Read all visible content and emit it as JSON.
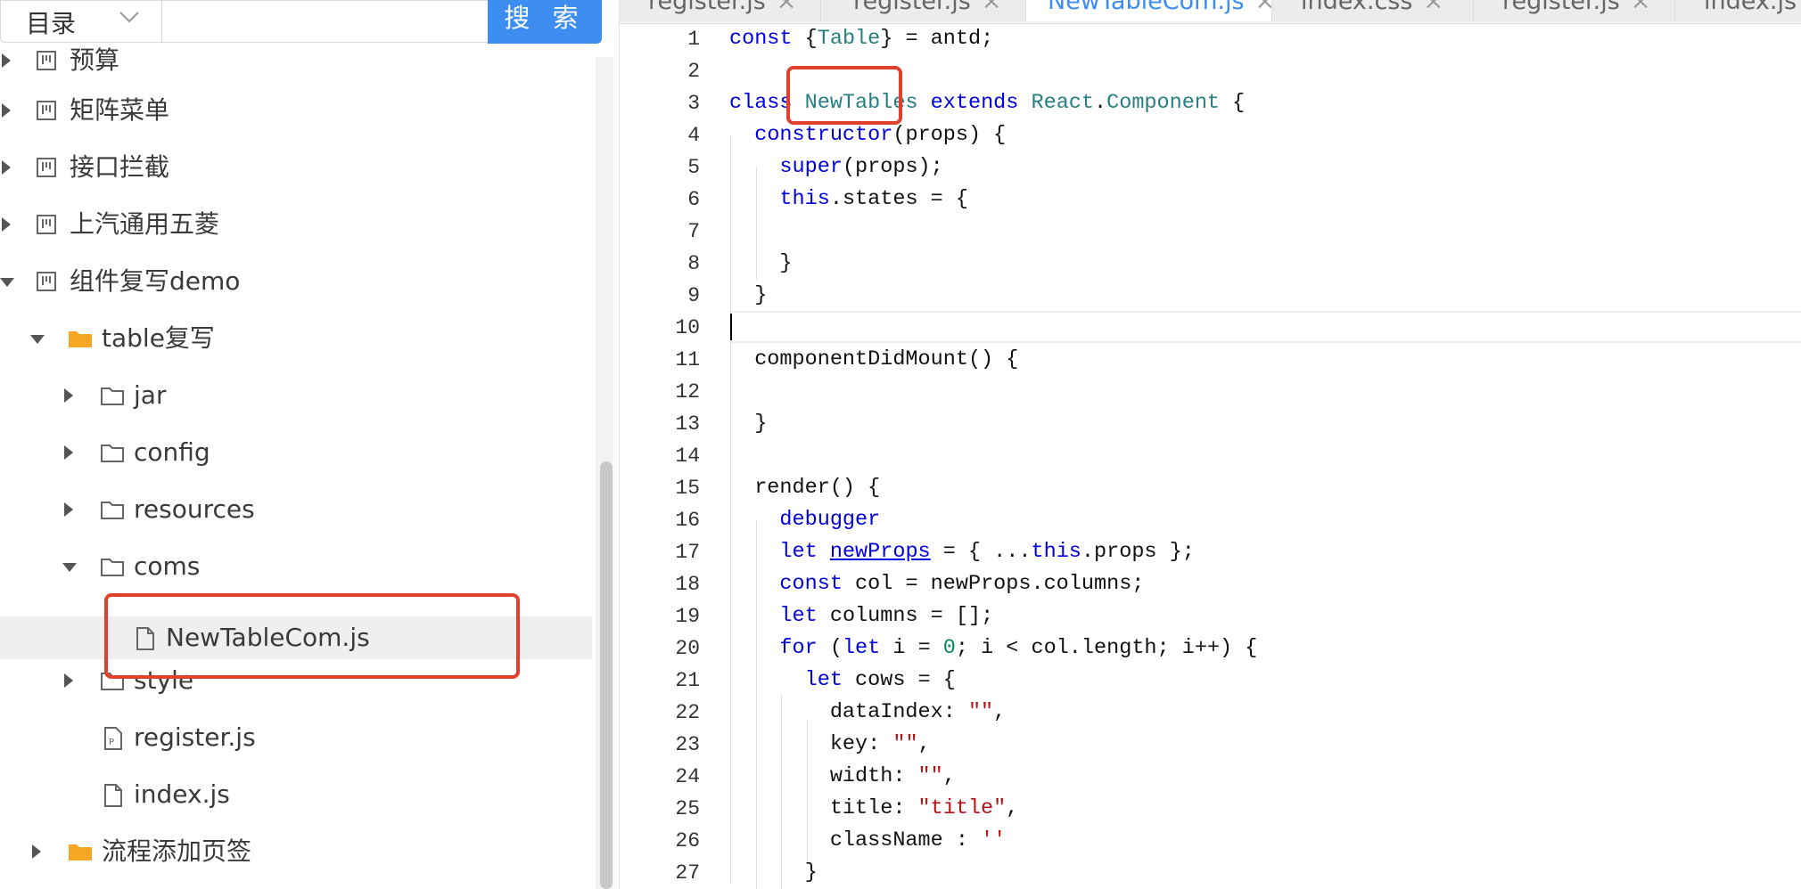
{
  "search": {
    "scope_label": "目录",
    "button_label": "搜 索"
  },
  "tree": {
    "nodes": [
      {
        "label": "预算"
      },
      {
        "label": "矩阵菜单"
      },
      {
        "label": "接口拦截"
      },
      {
        "label": "上汽通用五菱"
      },
      {
        "label": "组件复写demo"
      },
      {
        "label": "table复写"
      },
      {
        "label": "jar"
      },
      {
        "label": "config"
      },
      {
        "label": "resources"
      },
      {
        "label": "coms"
      },
      {
        "label": "NewTableCom.js"
      },
      {
        "label": "style"
      },
      {
        "label": "register.js"
      },
      {
        "label": "index.js"
      },
      {
        "label": "流程添加页签"
      }
    ]
  },
  "tabs": [
    {
      "label": "register.js"
    },
    {
      "label": "register.js"
    },
    {
      "label": "NewTableCom.js"
    },
    {
      "label": "index.css"
    },
    {
      "label": "register.js"
    },
    {
      "label": "index.js"
    }
  ],
  "editor": {
    "line_numbers": [
      "1",
      "2",
      "3",
      "4",
      "5",
      "6",
      "7",
      "8",
      "9",
      "10",
      "11",
      "12",
      "13",
      "14",
      "15",
      "16",
      "17",
      "18",
      "19",
      "20",
      "21",
      "22",
      "23",
      "24",
      "25",
      "26",
      "27"
    ],
    "code": {
      "l1_a": "const",
      "l1_b": " {",
      "l1_c": "Table",
      "l1_d": "} = antd;",
      "l3_a": "class",
      "l3_b": " ",
      "l3_c": "NewTables",
      "l3_d": " ",
      "l3_e": "extends",
      "l3_f": " ",
      "l3_g": "React",
      "l3_h": ".",
      "l3_i": "Component",
      "l3_j": " {",
      "l4_a": "  ",
      "l4_b": "constructor",
      "l4_c": "(props) {",
      "l5_a": "    ",
      "l5_b": "super",
      "l5_c": "(props);",
      "l6_a": "    ",
      "l6_b": "this",
      "l6_c": ".states = {",
      "l8": "    }",
      "l9": "  }",
      "l11": "  componentDidMount() {",
      "l13": "  }",
      "l15": "  render() {",
      "l16_a": "    ",
      "l16_b": "debugger",
      "l17_a": "    ",
      "l17_b": "let",
      "l17_c": " ",
      "l17_d": "newProps",
      "l17_e": " = { ...",
      "l17_f": "this",
      "l17_g": ".props };",
      "l18_a": "    ",
      "l18_b": "const",
      "l18_c": " col = newProps.columns;",
      "l19_a": "    ",
      "l19_b": "let",
      "l19_c": " columns = [];",
      "l20_a": "    ",
      "l20_b": "for",
      "l20_c": " (",
      "l20_d": "let",
      "l20_e": " i = ",
      "l20_f": "0",
      "l20_g": "; i < col.length; i++) {",
      "l21_a": "      ",
      "l21_b": "let",
      "l21_c": " cows = {",
      "l22_a": "        dataIndex: ",
      "l22_b": "\"\"",
      "l22_c": ",",
      "l23_a": "        key: ",
      "l23_b": "\"\"",
      "l23_c": ",",
      "l24_a": "        width: ",
      "l24_b": "\"\"",
      "l24_c": ",",
      "l25_a": "        title: ",
      "l25_b": "\"title\"",
      "l25_c": ",",
      "l26_a": "        className : ",
      "l26_b": "''",
      "l27": "      }"
    }
  }
}
